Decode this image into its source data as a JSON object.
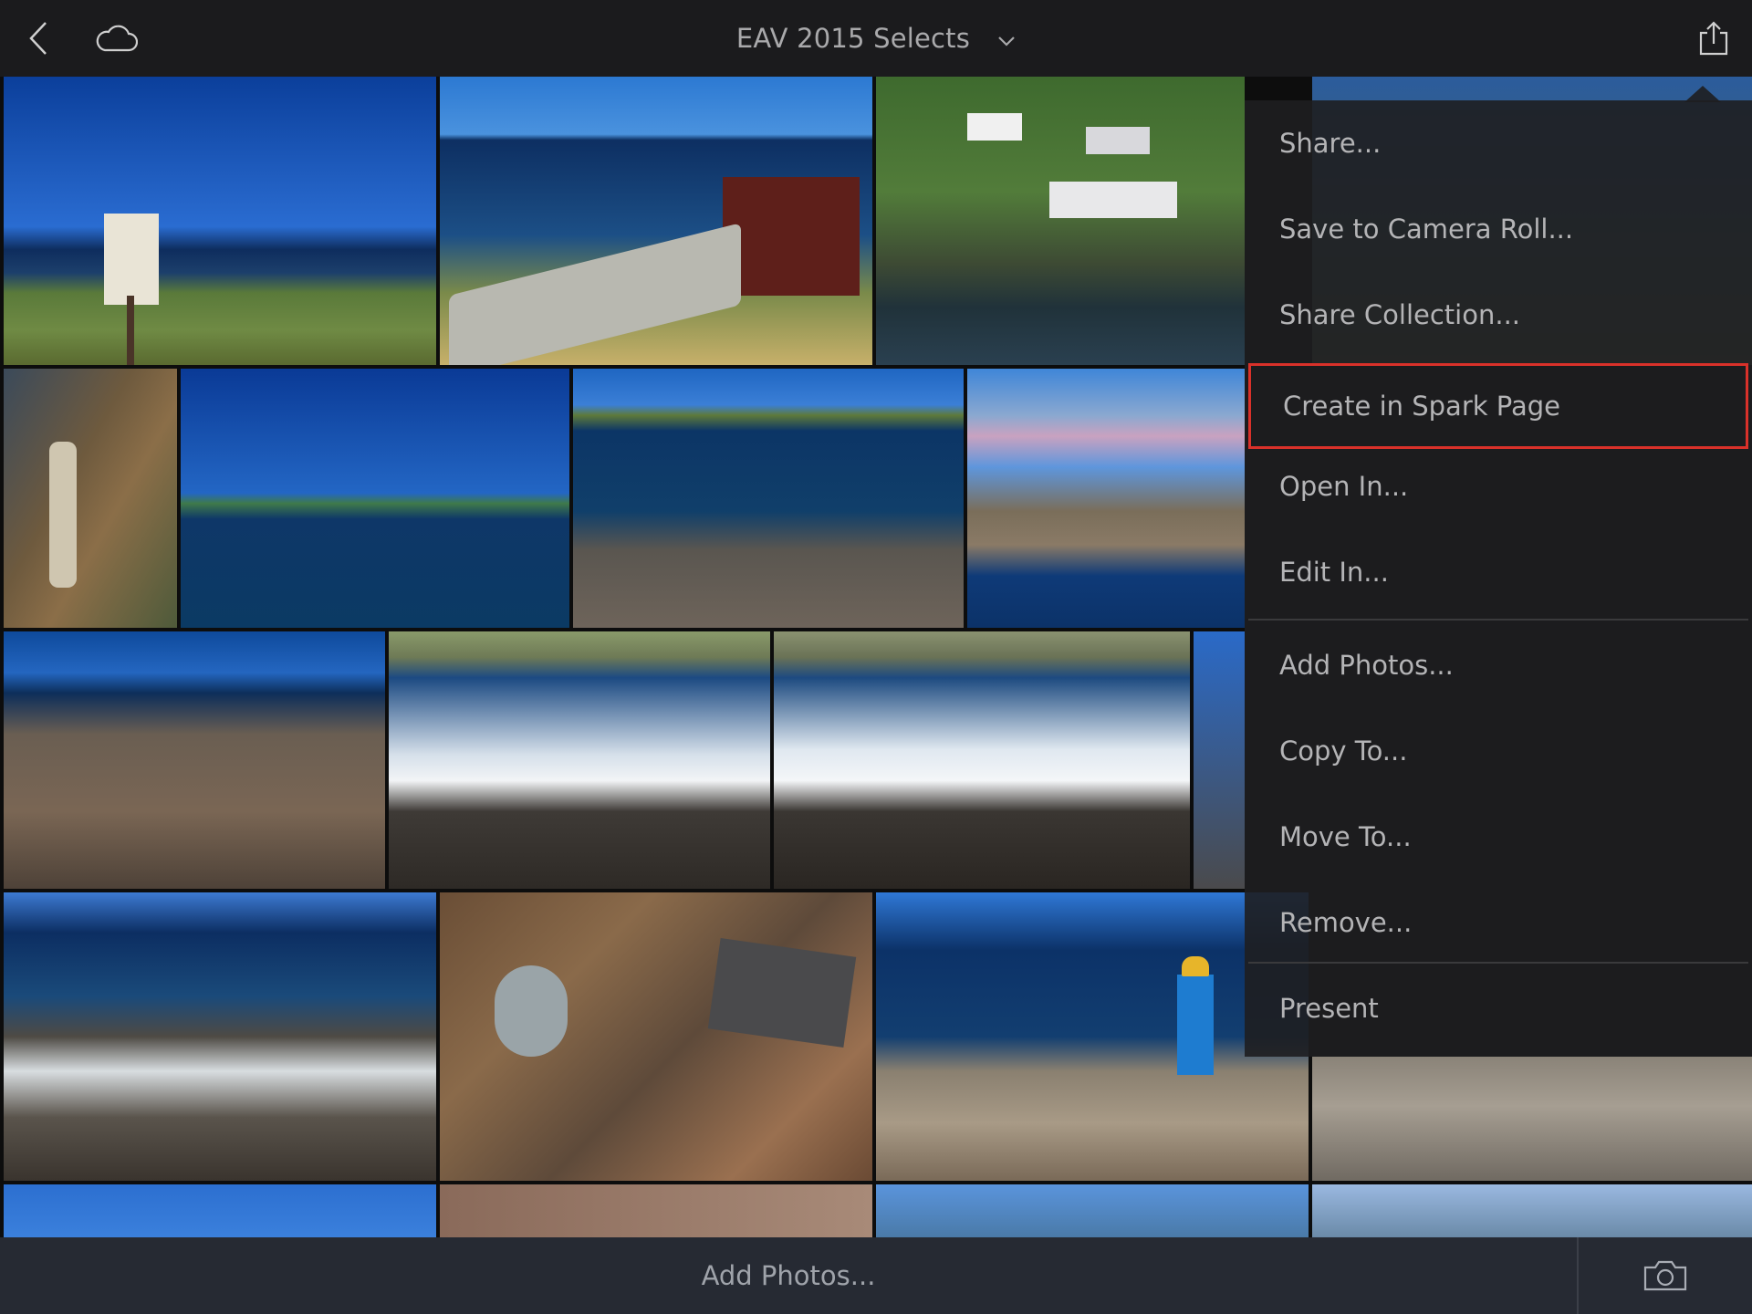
{
  "header": {
    "title": "EAV 2015 Selects",
    "back_icon": "back-chevron-icon",
    "cloud_icon": "cloud-sync-icon",
    "dropdown_icon": "chevron-down-icon",
    "share_icon": "share-export-icon"
  },
  "menu": {
    "items": [
      {
        "label": "Share..."
      },
      {
        "label": "Save to Camera Roll..."
      },
      {
        "label": "Share Collection..."
      },
      {
        "label": "Create in Spark Page"
      },
      {
        "label": "Open In..."
      },
      {
        "label": "Edit In..."
      },
      {
        "label": "Add Photos..."
      },
      {
        "label": "Copy To..."
      },
      {
        "label": "Move To..."
      },
      {
        "label": "Remove..."
      },
      {
        "label": "Present"
      }
    ],
    "highlight_color": "#d9312a"
  },
  "footer": {
    "add_label": "Add Photos...",
    "camera_icon": "camera-icon"
  },
  "colors": {
    "topbar": "#1b1b1d",
    "bottombar": "#262a33",
    "text": "#b4b4b6"
  }
}
